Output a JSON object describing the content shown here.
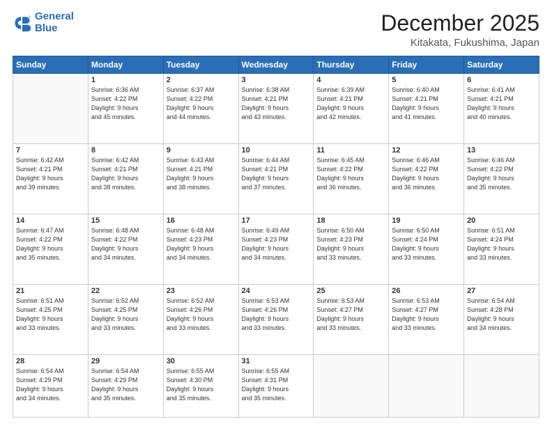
{
  "logo": {
    "line1": "General",
    "line2": "Blue"
  },
  "header": {
    "month": "December 2025",
    "location": "Kitakata, Fukushima, Japan"
  },
  "weekdays": [
    "Sunday",
    "Monday",
    "Tuesday",
    "Wednesday",
    "Thursday",
    "Friday",
    "Saturday"
  ],
  "weeks": [
    [
      {
        "day": "",
        "detail": ""
      },
      {
        "day": "1",
        "detail": "Sunrise: 6:36 AM\nSunset: 4:22 PM\nDaylight: 9 hours\nand 45 minutes."
      },
      {
        "day": "2",
        "detail": "Sunrise: 6:37 AM\nSunset: 4:22 PM\nDaylight: 9 hours\nand 44 minutes."
      },
      {
        "day": "3",
        "detail": "Sunrise: 6:38 AM\nSunset: 4:21 PM\nDaylight: 9 hours\nand 43 minutes."
      },
      {
        "day": "4",
        "detail": "Sunrise: 6:39 AM\nSunset: 4:21 PM\nDaylight: 9 hours\nand 42 minutes."
      },
      {
        "day": "5",
        "detail": "Sunrise: 6:40 AM\nSunset: 4:21 PM\nDaylight: 9 hours\nand 41 minutes."
      },
      {
        "day": "6",
        "detail": "Sunrise: 6:41 AM\nSunset: 4:21 PM\nDaylight: 9 hours\nand 40 minutes."
      }
    ],
    [
      {
        "day": "7",
        "detail": "Sunrise: 6:42 AM\nSunset: 4:21 PM\nDaylight: 9 hours\nand 39 minutes."
      },
      {
        "day": "8",
        "detail": "Sunrise: 6:42 AM\nSunset: 4:21 PM\nDaylight: 9 hours\nand 38 minutes."
      },
      {
        "day": "9",
        "detail": "Sunrise: 6:43 AM\nSunset: 4:21 PM\nDaylight: 9 hours\nand 38 minutes."
      },
      {
        "day": "10",
        "detail": "Sunrise: 6:44 AM\nSunset: 4:21 PM\nDaylight: 9 hours\nand 37 minutes."
      },
      {
        "day": "11",
        "detail": "Sunrise: 6:45 AM\nSunset: 4:22 PM\nDaylight: 9 hours\nand 36 minutes."
      },
      {
        "day": "12",
        "detail": "Sunrise: 6:46 AM\nSunset: 4:22 PM\nDaylight: 9 hours\nand 36 minutes."
      },
      {
        "day": "13",
        "detail": "Sunrise: 6:46 AM\nSunset: 4:22 PM\nDaylight: 9 hours\nand 35 minutes."
      }
    ],
    [
      {
        "day": "14",
        "detail": "Sunrise: 6:47 AM\nSunset: 4:22 PM\nDaylight: 9 hours\nand 35 minutes."
      },
      {
        "day": "15",
        "detail": "Sunrise: 6:48 AM\nSunset: 4:22 PM\nDaylight: 9 hours\nand 34 minutes."
      },
      {
        "day": "16",
        "detail": "Sunrise: 6:48 AM\nSunset: 4:23 PM\nDaylight: 9 hours\nand 34 minutes."
      },
      {
        "day": "17",
        "detail": "Sunrise: 6:49 AM\nSunset: 4:23 PM\nDaylight: 9 hours\nand 34 minutes."
      },
      {
        "day": "18",
        "detail": "Sunrise: 6:50 AM\nSunset: 4:23 PM\nDaylight: 9 hours\nand 33 minutes."
      },
      {
        "day": "19",
        "detail": "Sunrise: 6:50 AM\nSunset: 4:24 PM\nDaylight: 9 hours\nand 33 minutes."
      },
      {
        "day": "20",
        "detail": "Sunrise: 6:51 AM\nSunset: 4:24 PM\nDaylight: 9 hours\nand 33 minutes."
      }
    ],
    [
      {
        "day": "21",
        "detail": "Sunrise: 6:51 AM\nSunset: 4:25 PM\nDaylight: 9 hours\nand 33 minutes."
      },
      {
        "day": "22",
        "detail": "Sunrise: 6:52 AM\nSunset: 4:25 PM\nDaylight: 9 hours\nand 33 minutes."
      },
      {
        "day": "23",
        "detail": "Sunrise: 6:52 AM\nSunset: 4:26 PM\nDaylight: 9 hours\nand 33 minutes."
      },
      {
        "day": "24",
        "detail": "Sunrise: 6:53 AM\nSunset: 4:26 PM\nDaylight: 9 hours\nand 33 minutes."
      },
      {
        "day": "25",
        "detail": "Sunrise: 6:53 AM\nSunset: 4:27 PM\nDaylight: 9 hours\nand 33 minutes."
      },
      {
        "day": "26",
        "detail": "Sunrise: 6:53 AM\nSunset: 4:27 PM\nDaylight: 9 hours\nand 33 minutes."
      },
      {
        "day": "27",
        "detail": "Sunrise: 6:54 AM\nSunset: 4:28 PM\nDaylight: 9 hours\nand 34 minutes."
      }
    ],
    [
      {
        "day": "28",
        "detail": "Sunrise: 6:54 AM\nSunset: 4:29 PM\nDaylight: 9 hours\nand 34 minutes."
      },
      {
        "day": "29",
        "detail": "Sunrise: 6:54 AM\nSunset: 4:29 PM\nDaylight: 9 hours\nand 35 minutes."
      },
      {
        "day": "30",
        "detail": "Sunrise: 6:55 AM\nSunset: 4:30 PM\nDaylight: 9 hours\nand 35 minutes."
      },
      {
        "day": "31",
        "detail": "Sunrise: 6:55 AM\nSunset: 4:31 PM\nDaylight: 9 hours\nand 35 minutes."
      },
      {
        "day": "",
        "detail": ""
      },
      {
        "day": "",
        "detail": ""
      },
      {
        "day": "",
        "detail": ""
      }
    ]
  ]
}
